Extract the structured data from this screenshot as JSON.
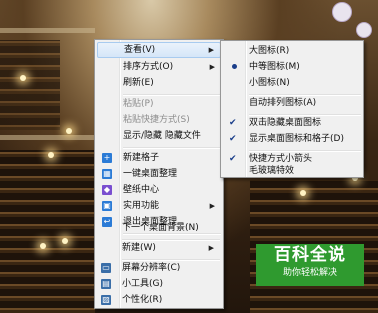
{
  "main_menu": {
    "items": [
      {
        "label": "查看(V)"
      },
      {
        "label": "排序方式(O)"
      },
      {
        "label": "刷新(E)"
      },
      {
        "label": "粘贴(P)"
      },
      {
        "label": "粘贴快捷方式(S)"
      },
      {
        "label": "显示/隐藏 隐藏文件"
      },
      {
        "label": "新建格子"
      },
      {
        "label": "一键桌面整理"
      },
      {
        "label": "壁纸中心"
      },
      {
        "label": "实用功能"
      },
      {
        "label": "退出桌面整理"
      },
      {
        "label": "下一个桌面背景(N)"
      },
      {
        "label": "新建(W)"
      },
      {
        "label": "屏幕分辨率(C)"
      },
      {
        "label": "小工具(G)"
      },
      {
        "label": "个性化(R)"
      }
    ]
  },
  "view_submenu": {
    "items": [
      {
        "label": "大图标(R)"
      },
      {
        "label": "中等图标(M)"
      },
      {
        "label": "小图标(N)"
      },
      {
        "label": "自动排列图标(A)"
      },
      {
        "label": "双击隐藏桌面图标"
      },
      {
        "label": "显示桌面图标和格子(D)"
      },
      {
        "label": "快捷方式小箭头"
      },
      {
        "label": "毛玻璃特效"
      }
    ]
  },
  "watermark": {
    "title": "百科全说",
    "subtitle": "助你轻松解决"
  },
  "colors": {
    "accent": "#1a3e8a",
    "watermark": "#2f9a2f"
  }
}
